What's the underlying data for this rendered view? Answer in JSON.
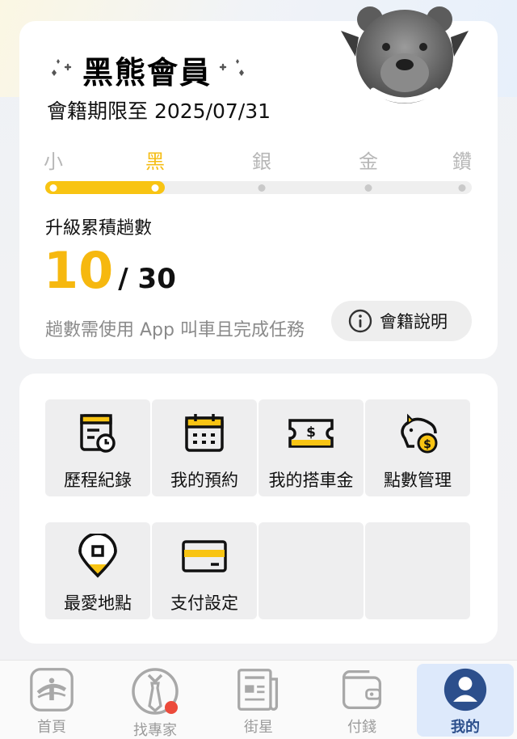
{
  "membership": {
    "tier_name": "黑熊會員",
    "expiry_text": "會籍期限至 2025/07/31",
    "levels": [
      "小",
      "黑",
      "銀",
      "金",
      "鑽"
    ],
    "current_level_index": 1,
    "progress_label": "升級累積趟數",
    "trips_current": "10",
    "trips_target": "/ 30",
    "hint": "趟數需使用 App 叫車且完成任務",
    "rules_button": "會籍說明"
  },
  "features": [
    {
      "label": "歷程紀錄",
      "icon": "history-icon"
    },
    {
      "label": "我的預約",
      "icon": "calendar-icon"
    },
    {
      "label": "我的搭車金",
      "icon": "ticket-icon"
    },
    {
      "label": "點數管理",
      "icon": "piggy-bank-icon"
    },
    {
      "label": "最愛地點",
      "icon": "map-pin-icon"
    },
    {
      "label": "支付設定",
      "icon": "credit-card-icon"
    }
  ],
  "bottom_nav": [
    {
      "label": "首頁",
      "icon": "home-logo-icon",
      "active": false
    },
    {
      "label": "找專家",
      "icon": "expert-tie-icon",
      "active": false,
      "badge": true
    },
    {
      "label": "街星",
      "icon": "newspaper-icon",
      "active": false
    },
    {
      "label": "付錢",
      "icon": "wallet-icon",
      "active": false
    },
    {
      "label": "我的",
      "icon": "profile-icon",
      "active": true
    }
  ],
  "colors": {
    "accent_yellow": "#f8c413",
    "active_nav_bg": "#dde9fb",
    "active_nav_text": "#2c4f8c",
    "badge_red": "#ec4a3b"
  }
}
